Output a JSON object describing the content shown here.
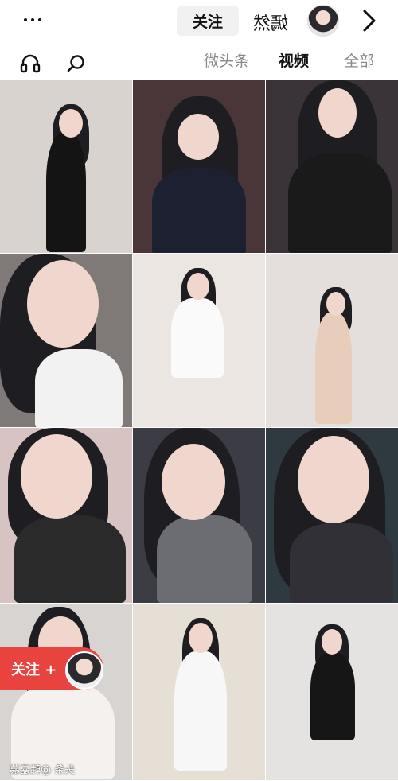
{
  "header": {
    "follow_label": "关注",
    "username": "嫣然"
  },
  "tabs": [
    {
      "label": "全部",
      "active": false
    },
    {
      "label": "视频",
      "active": true
    },
    {
      "label": "微头条",
      "active": false
    }
  ],
  "grid": {
    "tiles": [
      {
        "colors": {
          "bg": "#d9d3cf",
          "outfit": "#141414"
        }
      },
      {
        "colors": {
          "bg": "#4a3538",
          "outfit": "#1d2030"
        }
      },
      {
        "colors": {
          "bg": "#3a3438",
          "outfit": "#1a1a1a"
        }
      },
      {
        "colors": {
          "bg": "#7f7a78",
          "outfit": "#f2f2f2"
        }
      },
      {
        "colors": {
          "bg": "#ebe6e1",
          "outfit": "#fafafa"
        }
      },
      {
        "colors": {
          "bg": "#e4dfdc",
          "outfit": "#e9cdbb"
        }
      },
      {
        "colors": {
          "bg": "#d6c3c2",
          "outfit": "#2a2a2a"
        }
      },
      {
        "colors": {
          "bg": "#3c3c44",
          "outfit": "#6b6d72"
        }
      },
      {
        "colors": {
          "bg": "#2f3a40",
          "outfit": "#303036"
        }
      },
      {
        "colors": {
          "bg": "#d8d4d2",
          "outfit": "#f5f1ee"
        }
      },
      {
        "colors": {
          "bg": "#e6dfd6",
          "outfit": "#f7f7f7"
        }
      },
      {
        "colors": {
          "bg": "#e5e2e2",
          "outfit": "#161616"
        }
      }
    ]
  },
  "floating_follow": {
    "label": "关注 +"
  },
  "watermark": "头条 @韩嘉慕"
}
